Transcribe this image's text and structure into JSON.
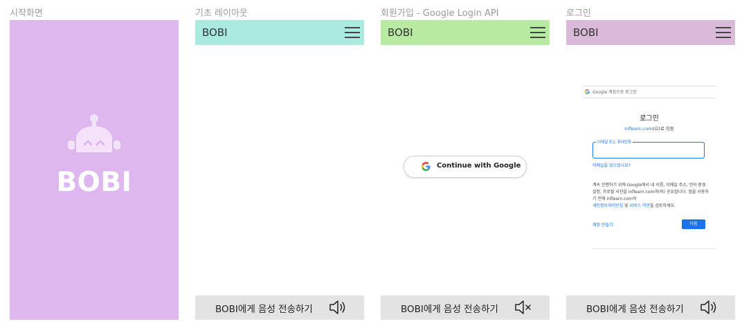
{
  "frames": {
    "splash": {
      "title": "시작화면",
      "brand": "BOBI",
      "bg": "#dfb7ef"
    },
    "basic": {
      "title": "기초 레이아웃",
      "brand": "BOBI",
      "header_bg": "#a8eae0",
      "voice_text": "BOBI에게 음성 전송하기",
      "icon": "speaker-on-icon"
    },
    "signup": {
      "title": "회원가입 - Google Login API",
      "brand": "BOBI",
      "header_bg": "#b7eba1",
      "google_button": "Continue with Google",
      "voice_text": "BOBI에게 음성 전송하기",
      "icon": "speaker-muted-icon"
    },
    "login": {
      "title": "로그인",
      "brand": "BOBI",
      "header_bg": "#d9bbd9",
      "voice_text": "BOBI에게 음성 전송하기",
      "icon": "speaker-on-icon"
    }
  },
  "google_login": {
    "top_bar": "Google 계정으로 로그인",
    "heading": "로그인",
    "sub_link": "inflearn.com",
    "sub_rest": "(으)로 이동",
    "input_label": "이메일 또는 휴대전화",
    "forgot": "이메일을 잊으셨나요?",
    "body_1": "계속 진행하기 위해 Google에서 내 이름, 이메일 주소, 언어 환경설정, 프로필 사진을 inflearn.com과(와) 공유합니다. 앱을 사용하기 전에 inflearn.com의",
    "privacy_link": "개인정보처리방침",
    "and": " 및 ",
    "terms_link": "서비스 약관",
    "body_2": "을 검토하세요.",
    "create_account": "계정 만들기",
    "next": "다음"
  }
}
